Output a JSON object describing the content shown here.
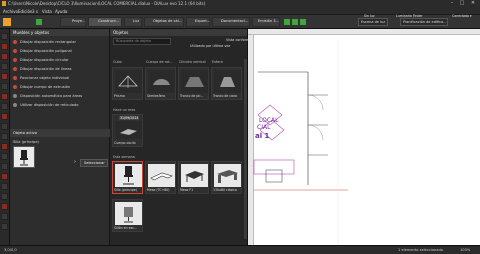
{
  "window": {
    "title": "C:\\Users\\Nicole\\Desktop\\CICLO 3\\Iluminacion\\LOCAL COMERCIAL.dialux - DIALux evo 12.1  (64 bits)",
    "minimize": "–",
    "maximize": "□",
    "close": "✕"
  },
  "menu": {
    "items": [
      "Archivo",
      "Edición",
      "3 s",
      "Vista",
      "Ayuda"
    ]
  },
  "toolbar": {
    "buttons": [
      "Proye...",
      "Construcc...",
      "Luz",
      "Objetos de cál...",
      "Export...",
      "Documentaci...",
      "Emisión 3..."
    ],
    "scene_select": "Escena de luz 1",
    "planificacion": "Planificación de edifica...",
    "mode_label": "Sin luz",
    "mode_label2": "Luminario Finder",
    "user": "Conectado",
    "user_caret": "▾"
  },
  "left_panel": {
    "header": "Muebles y objetos",
    "items": [
      "Dibujar disposición rectangular",
      "Dibujar disposición poligonal",
      "Dibujar disposición circular",
      "Dibujar disposición de líneas",
      "Posicionar objeto individual",
      "Dibujar cuerpo de extrusión",
      "Disposición automática para áreas",
      "Utilizar disposición de reticulado"
    ],
    "active_header": "Objeto activo",
    "active_item": "Silla (príncipe)",
    "select_button": "Seleccionar",
    "select_arrow": "›"
  },
  "catalog": {
    "header": "Objetos",
    "search_placeholder": "Búsqueda de objeto",
    "sort": "Utilizado por última vez",
    "view_toggle": "Vista conforme",
    "shapes_labels": [
      "Cubo",
      "Cuerpo de rot...",
      "Cilindro vertical",
      "Esfera"
    ],
    "shapes_row2": [
      "Prisma",
      "Semiesfera",
      "Tronco de pir...",
      "Tronco de cono"
    ],
    "recent_label": "Hace un mes",
    "recent_date": "31/09/2024",
    "recent_item": "Cuerpo oscilo",
    "recent_items_label": "Esta semana",
    "row3": [
      "Silla (príncipe)",
      "Mesa (TC+80)",
      "Mesa F1",
      "130x80 clásica"
    ],
    "row4": [
      "Sillón en esc..."
    ]
  },
  "canvas": {
    "text1": "LOCAL",
    "text2": "CIAL",
    "text3": "al 1"
  },
  "status": {
    "left": "3,0/0,0",
    "right": "1 elemento seleccionado",
    "zoom": "100%"
  }
}
